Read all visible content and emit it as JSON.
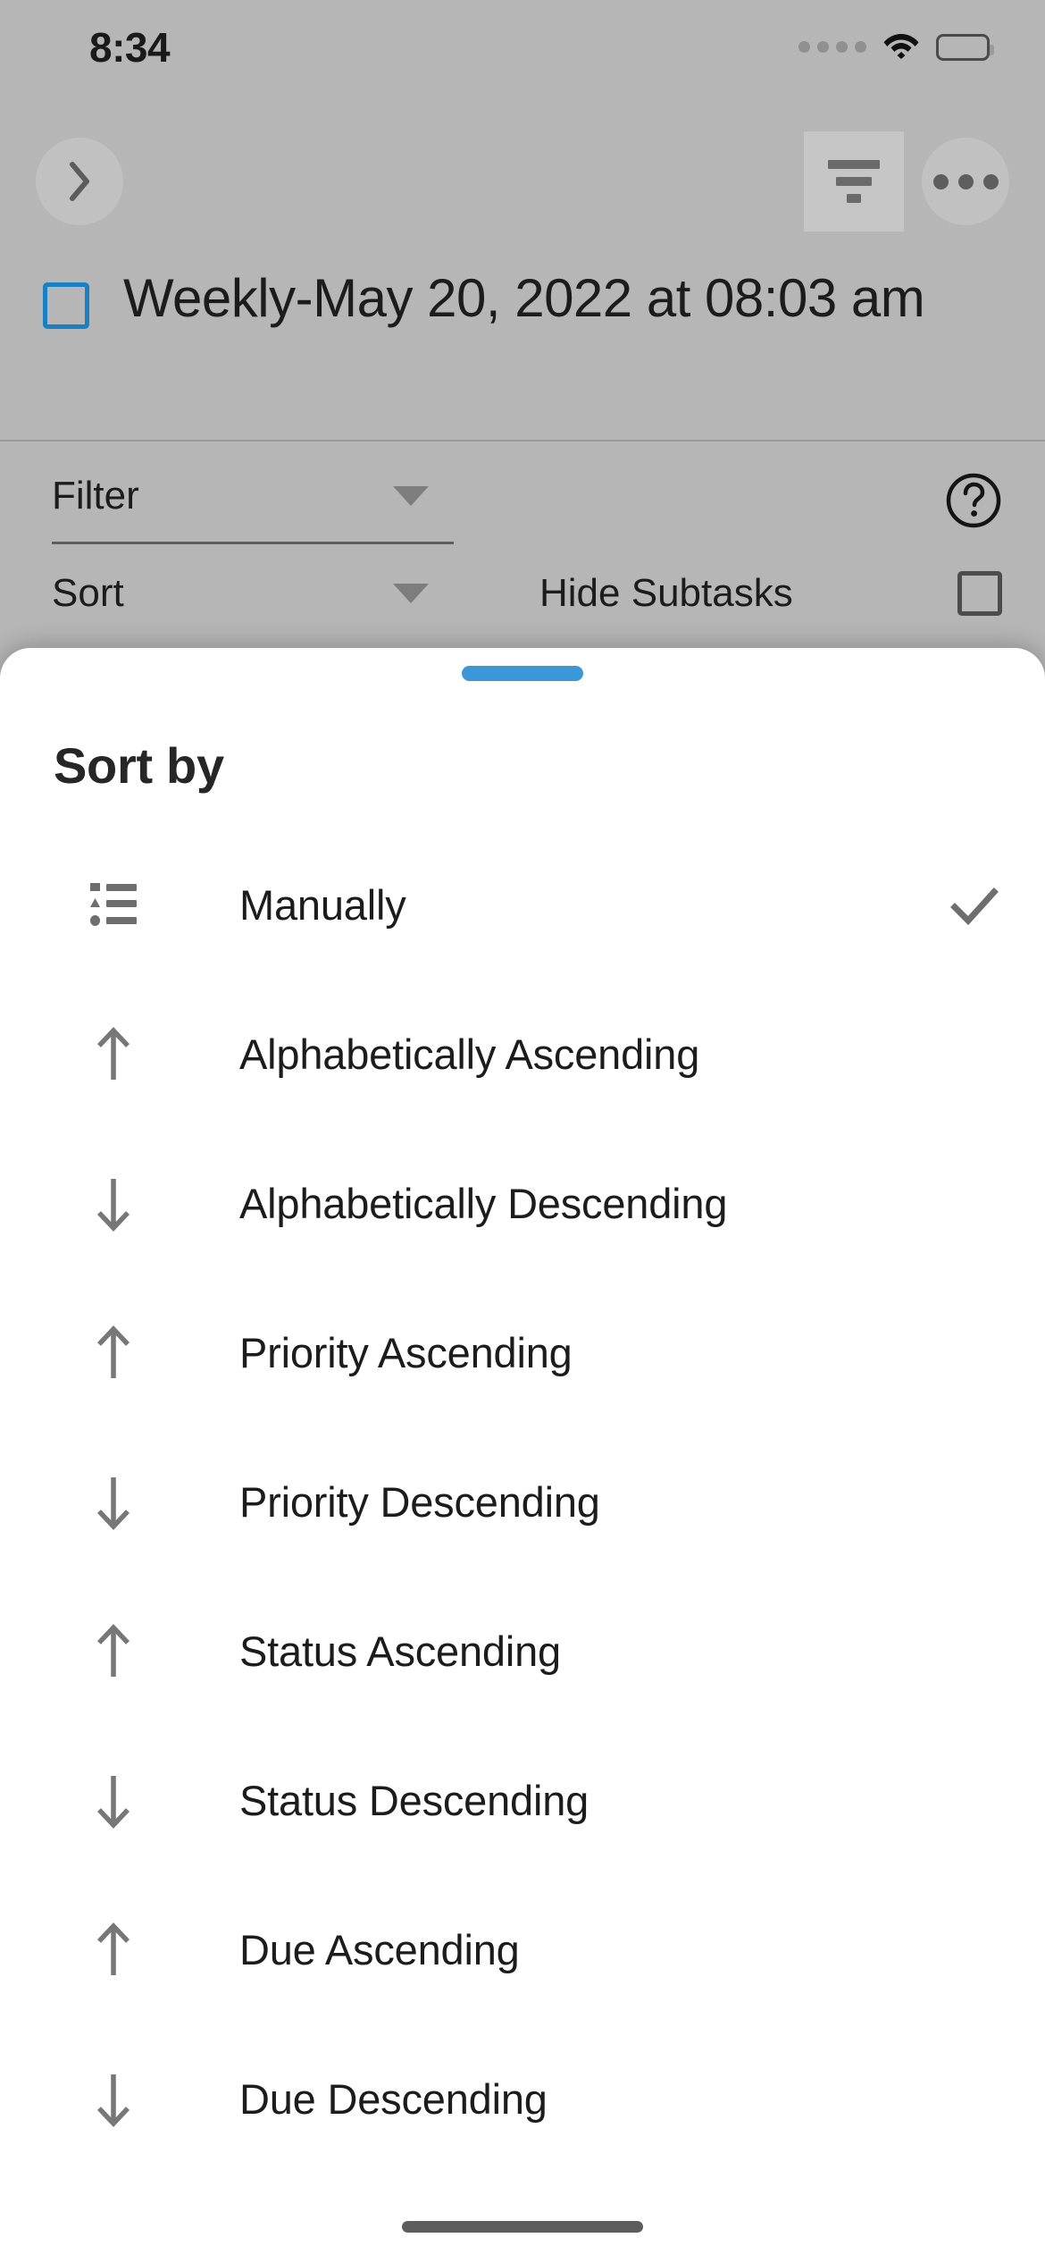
{
  "status_bar": {
    "time": "8:34",
    "signal_icon": "signal-dots-icon",
    "wifi_icon": "wifi-icon",
    "battery_icon": "battery-full-icon"
  },
  "nav_bar": {
    "back_icon": "chevron-right-icon",
    "filter_icon": "filter-icon",
    "more_icon": "more-horizontal-icon"
  },
  "header": {
    "checkbox_checked": false,
    "title": "Weekly-May 20, 2022 at 08:03 am",
    "checkbox_color": "#1b7fc4"
  },
  "controls": {
    "filter_label": "Filter",
    "sort_label": "Sort",
    "hide_subtasks_label": "Hide Subtasks",
    "help_icon": "help-circle-icon",
    "hide_subtasks_checked": false
  },
  "sheet": {
    "handle_color": "#3b97d8",
    "title": "Sort by",
    "options": [
      {
        "label": "Manually",
        "icon": "list-order-icon",
        "selected": true,
        "check": "✓"
      },
      {
        "label": "Alphabetically Ascending",
        "icon": "arrow-up-icon",
        "selected": false,
        "check": ""
      },
      {
        "label": "Alphabetically Descending",
        "icon": "arrow-down-icon",
        "selected": false,
        "check": ""
      },
      {
        "label": "Priority Ascending",
        "icon": "arrow-up-icon",
        "selected": false,
        "check": ""
      },
      {
        "label": "Priority Descending",
        "icon": "arrow-down-icon",
        "selected": false,
        "check": ""
      },
      {
        "label": "Status Ascending",
        "icon": "arrow-up-icon",
        "selected": false,
        "check": ""
      },
      {
        "label": "Status Descending",
        "icon": "arrow-down-icon",
        "selected": false,
        "check": ""
      },
      {
        "label": "Due Ascending",
        "icon": "arrow-up-icon",
        "selected": false,
        "check": ""
      },
      {
        "label": "Due Descending",
        "icon": "arrow-down-icon",
        "selected": false,
        "check": ""
      }
    ]
  },
  "system": {
    "home_indicator": "home-indicator"
  }
}
